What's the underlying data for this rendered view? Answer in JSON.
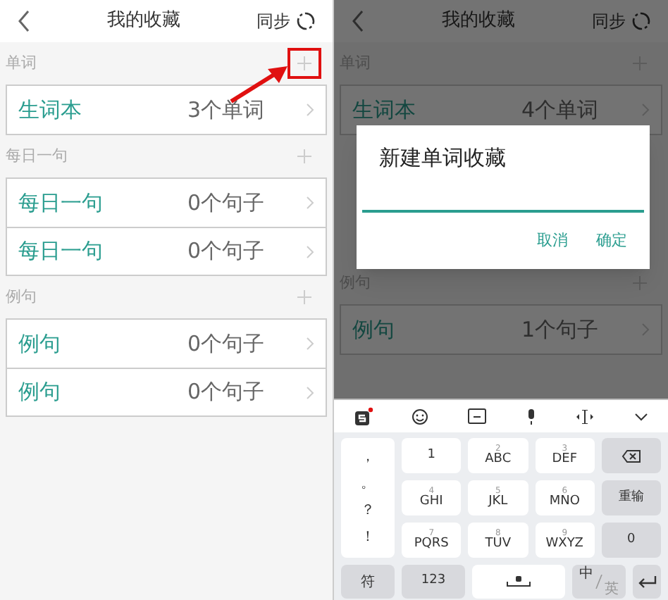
{
  "left": {
    "header": {
      "title": "我的收藏",
      "sync": "同步"
    },
    "sections": [
      {
        "title": "单词",
        "highlighted": true,
        "rows": [
          {
            "name": "生词本",
            "count": "3个单词"
          }
        ]
      },
      {
        "title": "每日一句",
        "highlighted": false,
        "rows": [
          {
            "name": "每日一句",
            "count": "0个句子"
          },
          {
            "name": "每日一句",
            "count": "0个句子"
          }
        ]
      },
      {
        "title": "例句",
        "highlighted": false,
        "rows": [
          {
            "name": "例句",
            "count": "0个句子"
          },
          {
            "name": "例句",
            "count": "0个句子"
          }
        ]
      }
    ]
  },
  "right": {
    "header": {
      "title": "我的收藏",
      "sync": "同步"
    },
    "sections": [
      {
        "title": "单词",
        "highlighted": false,
        "rows": [
          {
            "name": "生词本",
            "count": "4个单词"
          }
        ]
      },
      {
        "title": "例句",
        "highlighted": false,
        "rows": [
          {
            "name": "例句",
            "count": "1个句子"
          }
        ]
      }
    ],
    "dialog": {
      "title": "新建单词收藏",
      "buttons": [
        "取消",
        "确定"
      ]
    },
    "keyboard": {
      "punctuation": [
        "，",
        "。",
        "？",
        "！"
      ],
      "keys": [
        {
          "kind": "digit",
          "letters": "1"
        },
        {
          "kind": "digit",
          "digit": "2",
          "letters": "ABC"
        },
        {
          "kind": "digit",
          "digit": "3",
          "letters": "DEF"
        },
        {
          "kind": "backspace"
        },
        {
          "kind": "digit",
          "digit": "4",
          "letters": "GHI"
        },
        {
          "kind": "digit",
          "digit": "5",
          "letters": "JKL"
        },
        {
          "kind": "digit",
          "digit": "6",
          "letters": "MNO"
        },
        {
          "kind": "text",
          "label": "重输"
        },
        {
          "kind": "digit",
          "digit": "7",
          "letters": "PQRS"
        },
        {
          "kind": "digit",
          "digit": "8",
          "letters": "TUV"
        },
        {
          "kind": "digit",
          "digit": "9",
          "letters": "WXYZ"
        },
        {
          "kind": "text",
          "label": "0"
        }
      ],
      "bottom": {
        "symbols": "符",
        "numbers": "123",
        "lang_main": "中",
        "lang_alt": "英"
      }
    }
  }
}
